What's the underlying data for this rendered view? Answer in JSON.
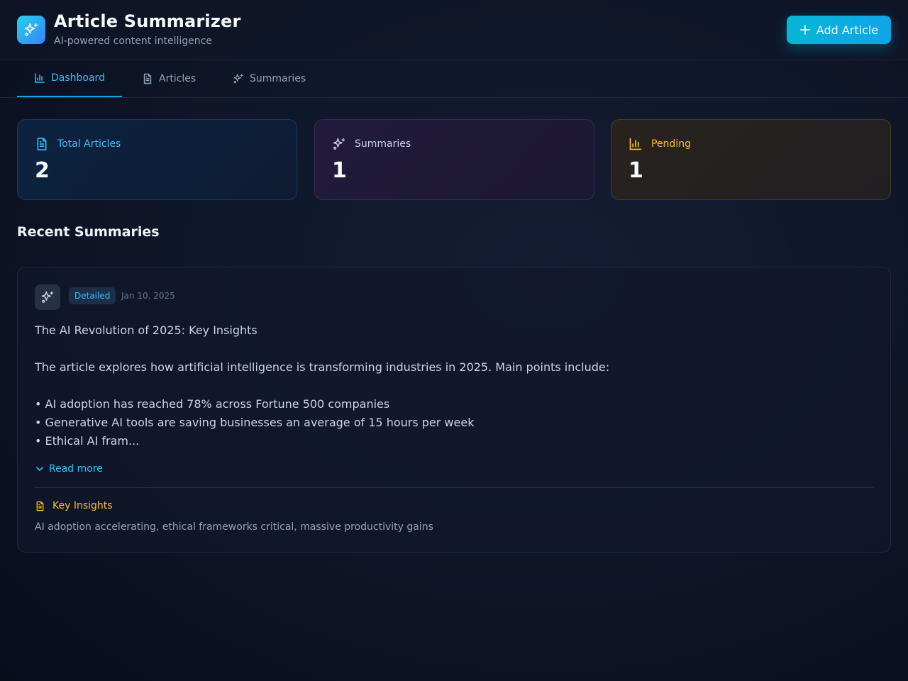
{
  "app": {
    "title": "Article Summarizer",
    "subtitle": "AI-powered content intelligence",
    "add_button_label": "Add Article",
    "logo_icon": "sparkles-icon"
  },
  "tabs": [
    {
      "label": "Dashboard",
      "icon": "bar-chart-icon",
      "active": true
    },
    {
      "label": "Articles",
      "icon": "file-text-icon",
      "active": false
    },
    {
      "label": "Summaries",
      "icon": "sparkles-icon",
      "active": false
    }
  ],
  "stats": [
    {
      "label": "Total Articles",
      "value": "2",
      "icon": "file-text-icon",
      "color": "#38bdf8"
    },
    {
      "label": "Summaries",
      "value": "1",
      "icon": "sparkles-icon",
      "color": "#cbd5e1"
    },
    {
      "label": "Pending",
      "value": "1",
      "icon": "bar-chart-icon",
      "color": "#fbbf24"
    }
  ],
  "recent": {
    "title": "Recent Summaries",
    "items": [
      {
        "badge": "Detailed",
        "date": "Jan 10, 2025",
        "lines": [
          "The AI Revolution of 2025: Key Insights",
          "",
          "The article explores how artificial intelligence is transforming industries in 2025. Main points include:",
          "",
          "• AI adoption has reached 78% across Fortune 500 companies",
          "• Generative AI tools are saving businesses an average of 15 hours per week",
          "• Ethical AI fram..."
        ],
        "read_more_label": "Read more",
        "insights_label": "Key Insights",
        "insights_text": "AI adoption accelerating, ethical frameworks critical, massive productivity gains"
      }
    ]
  },
  "colors": {
    "accent": "#0ea5e9",
    "amber": "#fbbf24",
    "background": "#0f172a"
  }
}
